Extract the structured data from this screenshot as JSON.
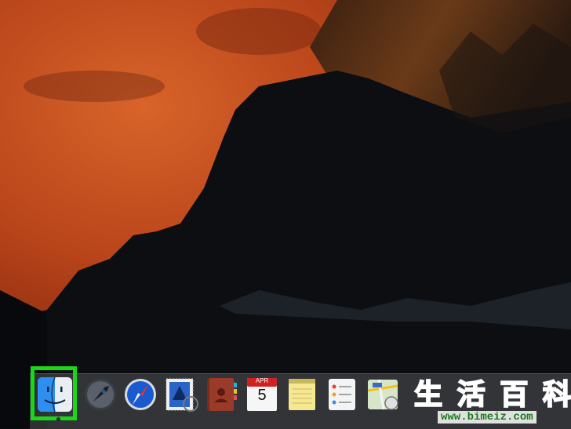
{
  "desktop": {
    "wallpaper": "mountain-cliff-at-sunset",
    "colors": {
      "sky": "#c4501a",
      "cliff_shadow": "#0c0e12",
      "selection": "#18d818"
    }
  },
  "dock": {
    "items": [
      {
        "id": "finder",
        "icon": "finder-icon",
        "highlighted": true,
        "running": true
      },
      {
        "id": "launchpad",
        "icon": "rocket-icon"
      },
      {
        "id": "safari",
        "icon": "compass-icon"
      },
      {
        "id": "mail",
        "icon": "stamp-icon"
      },
      {
        "id": "contacts",
        "icon": "address-book-icon"
      },
      {
        "id": "calendar",
        "icon": "calendar-icon",
        "month": "APR",
        "day": "5"
      },
      {
        "id": "notes",
        "icon": "notepad-icon"
      },
      {
        "id": "reminders",
        "icon": "checklist-icon"
      },
      {
        "id": "maps",
        "icon": "map-icon"
      }
    ]
  },
  "watermark": {
    "chars": [
      "生",
      "活",
      "百",
      "科"
    ],
    "url": "www.bimeiz.com"
  }
}
